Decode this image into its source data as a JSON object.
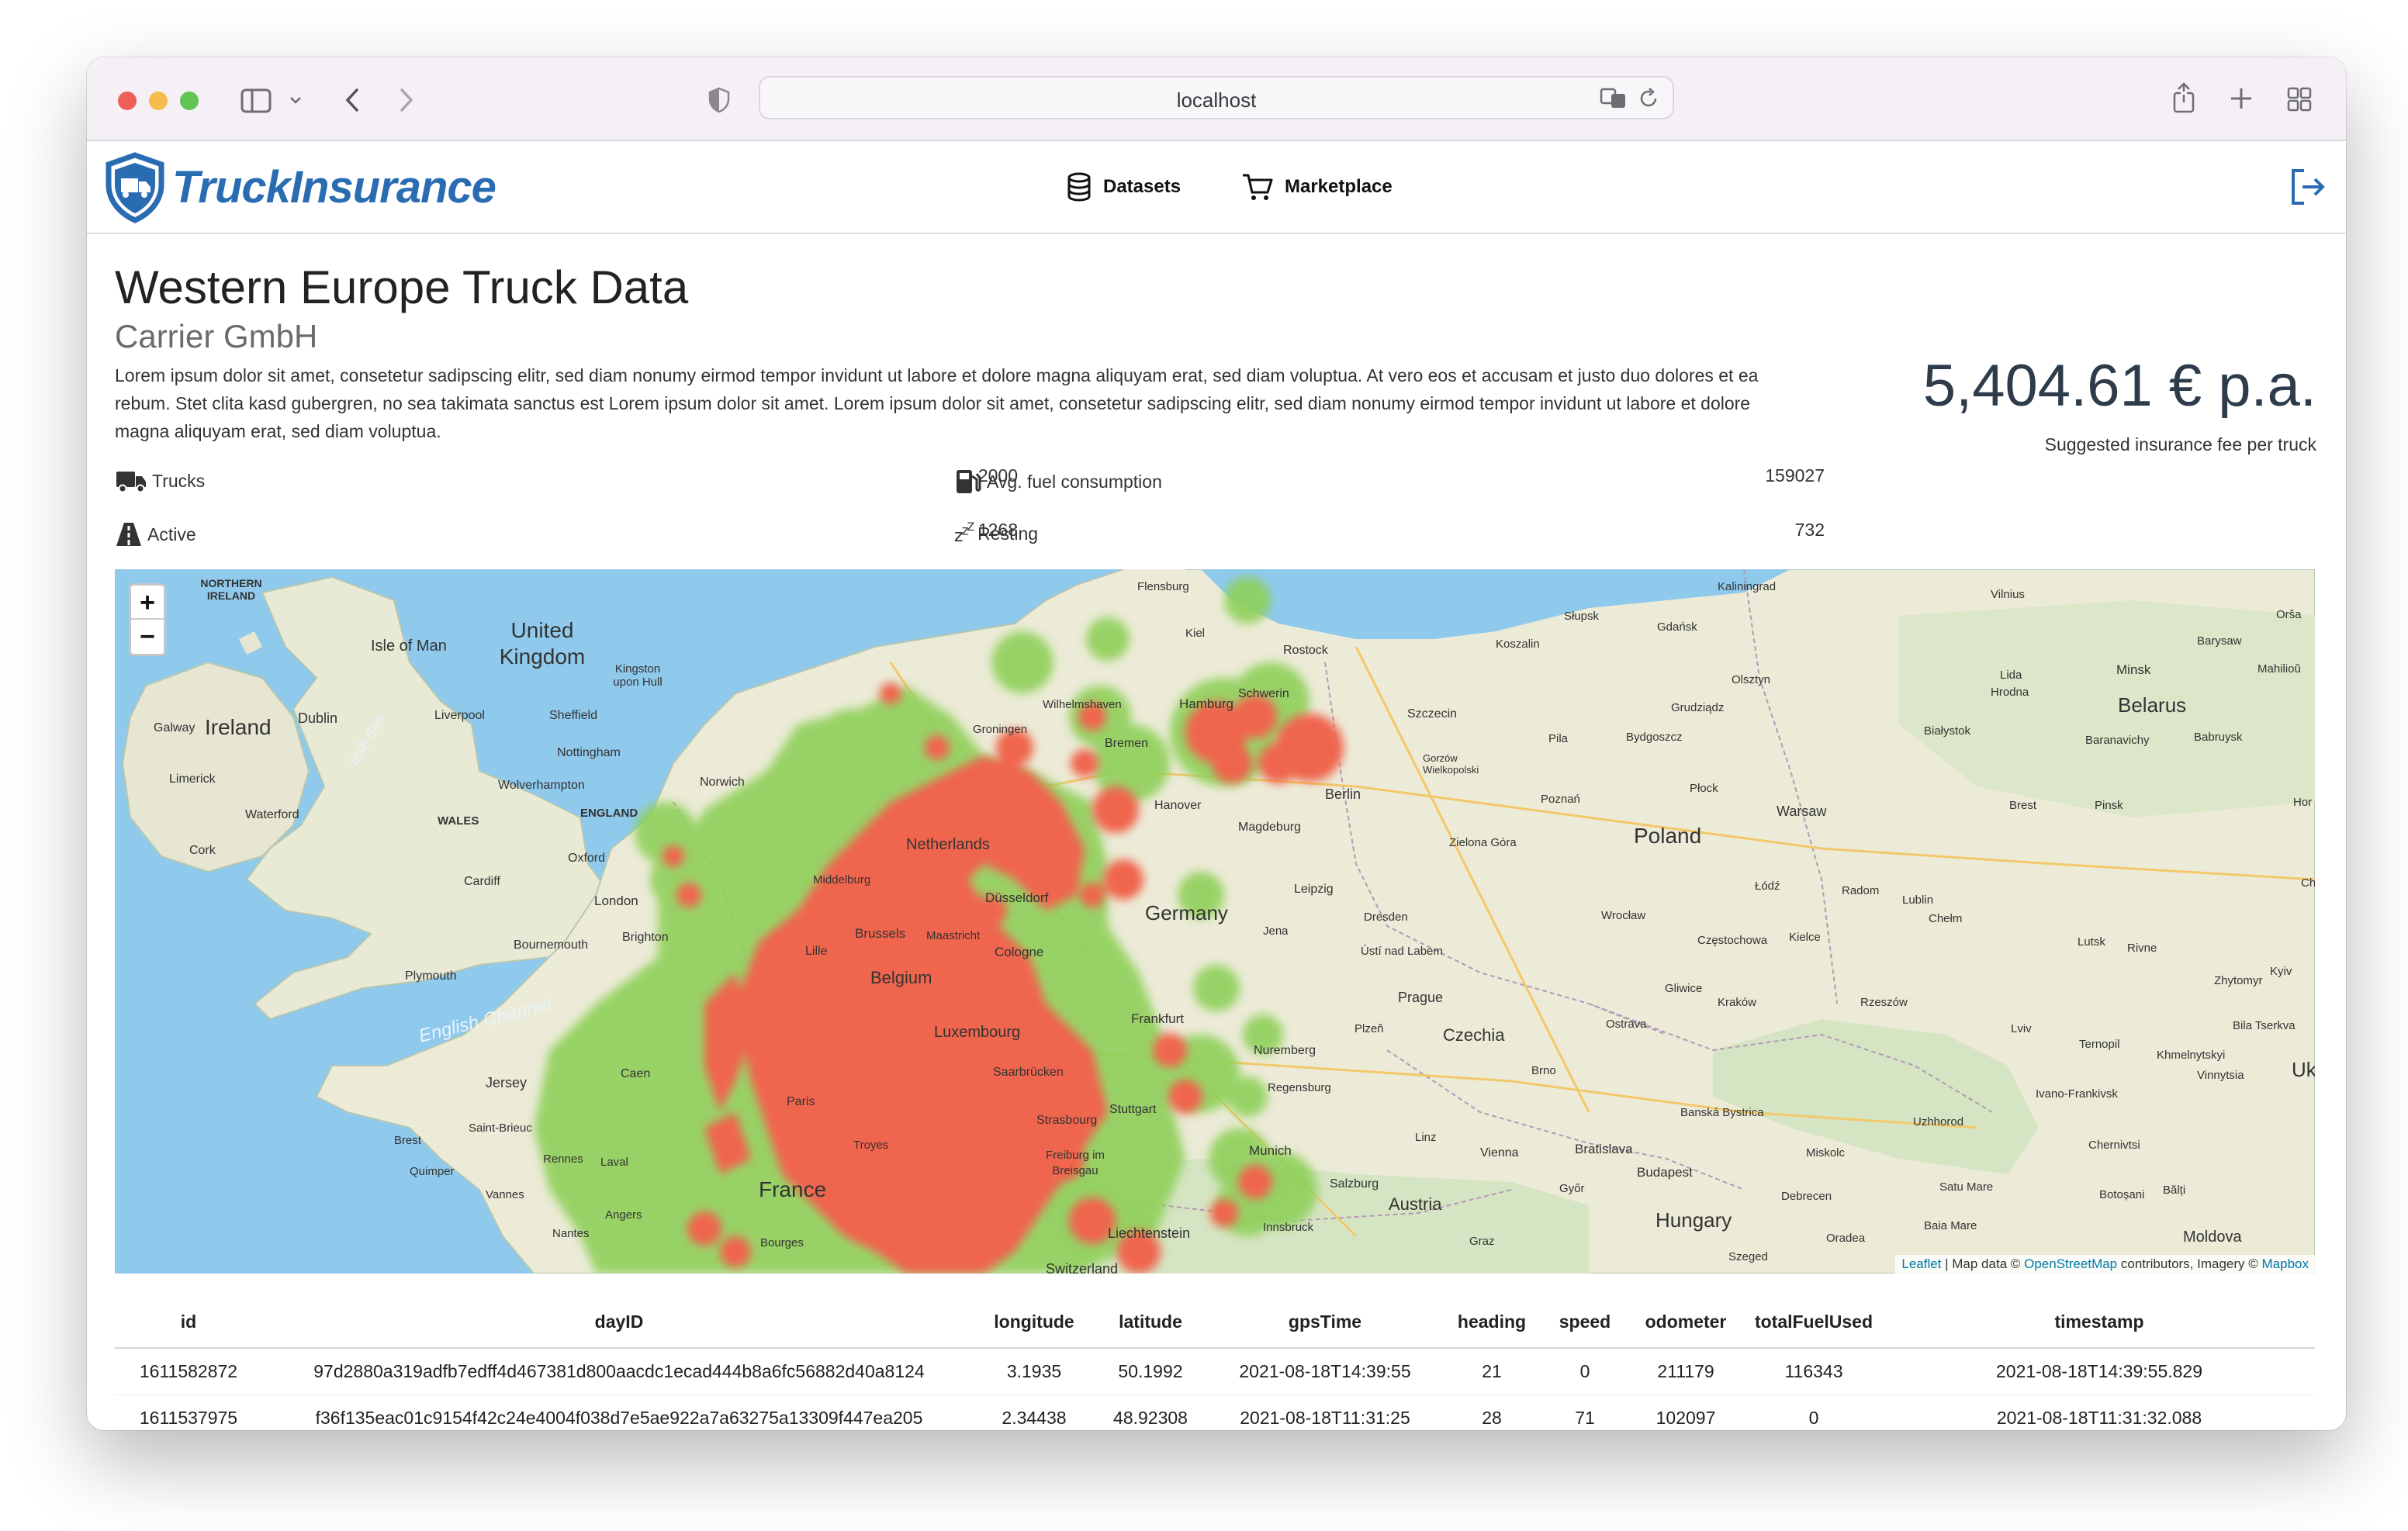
{
  "browser": {
    "address": "localhost"
  },
  "app": {
    "brand": "TruckInsurance",
    "nav": {
      "datasets": "Datasets",
      "marketplace": "Marketplace"
    },
    "colors": {
      "brand": "#2a6cb2",
      "heat_core": "#f0654d",
      "heat_edge": "#8fd05a"
    }
  },
  "dataset": {
    "title": "Western Europe Truck Data",
    "provider": "Carrier GmbH",
    "description": "Lorem ipsum dolor sit amet, consetetur sadipscing elitr, sed diam nonumy eirmod tempor invidunt ut labore et dolore magna aliquyam erat, sed diam voluptua. At vero eos et accusam et justo duo dolores et ea rebum. Stet clita kasd gubergren, no sea takimata sanctus est Lorem ipsum dolor sit amet. Lorem ipsum dolor sit amet, consetetur sadipscing elitr, sed diam nonumy eirmod tempor invidunt ut labore et dolore magna aliquyam erat, sed diam voluptua.",
    "price": "5,404.61 € p.a.",
    "price_label": "Suggested insurance fee per truck",
    "stats": {
      "trucks_label": "Trucks",
      "trucks_value": "2000",
      "fuel_label": "Avg. fuel consumption",
      "fuel_value": "159027",
      "active_label": "Active",
      "active_value": "1268",
      "resting_label": "Resting",
      "resting_value": "732"
    }
  },
  "map": {
    "zoom_in": "+",
    "zoom_out": "−",
    "attribution": {
      "leaflet": "Leaflet",
      "sep": " | Map data © ",
      "osm": "OpenStreetMap",
      "mid": " contributors, Imagery © ",
      "mapbox": "Mapbox"
    },
    "labels": [
      "NORTHERN IRELAND",
      "Isle of Man",
      "United Kingdom",
      "Ireland",
      "Dublin",
      "Galway",
      "Limerick",
      "Waterford",
      "Cork",
      "Liverpool",
      "Sheffield",
      "Kingston upon Hull",
      "Nottingham",
      "WALES",
      "ENGLAND",
      "Cardiff",
      "Oxford",
      "London",
      "Wolverhampton",
      "Norwich",
      "Bournemouth",
      "Brighton",
      "Plymouth",
      "English Channel",
      "Irish Sea",
      "Jersey",
      "Caen",
      "Saint-Brieuc",
      "Brest",
      "Quimper",
      "Rennes",
      "Laval",
      "Vannes",
      "Angers",
      "Nantes",
      "France",
      "Paris",
      "Troyes",
      "Bourges",
      "Lille",
      "Brussels",
      "Belgium",
      "Maastricht",
      "Luxembourg",
      "Middelburg",
      "Netherlands",
      "Groningen",
      "Düsseldorf",
      "Cologne",
      "Frankfurt",
      "Saarbrücken",
      "Strasbourg",
      "Stuttgart",
      "Freiburg im Breisgau",
      "Liechtenstein",
      "Switzerland",
      "Flensburg",
      "Kiel",
      "Wilhelmshaven",
      "Hamburg",
      "Bremen",
      "Schwerin",
      "Rostock",
      "Hanover",
      "Magdeburg",
      "Berlin",
      "Germany",
      "Leipzig",
      "Jena",
      "Dresden",
      "Nuremberg",
      "Regensburg",
      "Munich",
      "Innsbruck",
      "Salzburg",
      "Austria",
      "Graz",
      "Vienna",
      "Linz",
      "Czechia",
      "Prague",
      "Plzeň",
      "Brno",
      "Ústí nad Labem",
      "Ostrava",
      "Bratislava",
      "Győr",
      "Budapest",
      "Hungary",
      "Szeged",
      "Debrecen",
      "Oradea",
      "Poland",
      "Warsaw",
      "Szczecin",
      "Gorzów Wielkopolski",
      "Zielona Góra",
      "Poznań",
      "Bydgoszcz",
      "Gdańsk",
      "Koszalin",
      "Słupsk",
      "Olsztyn",
      "Grudziądz",
      "Płock",
      "Łódź",
      "Radom",
      "Wrocław",
      "Częstochowa",
      "Kielce",
      "Lublin",
      "Chełm",
      "Kraków",
      "Rzeszów",
      "Gliwice",
      "Białystok",
      "Hrodna",
      "Brest",
      "Pinsk",
      "Lutsk",
      "Rivne",
      "Lviv",
      "Ternopil",
      "Ivano-Frankivsk",
      "Chernivtsi",
      "Uzhhorod",
      "Banská Bystrica",
      "Miskolc",
      "Satu Mare",
      "Baia Mare",
      "Botoșani",
      "Bălți",
      "Moldova",
      "Khmelnytskyi",
      "Vinnytsia",
      "Bila Tserkva",
      "Zhytomyr",
      "Kyiv",
      "Uk",
      "Kaliningrad",
      "Vilnius",
      "Lida",
      "Minsk",
      "Belarus",
      "Barysaw",
      "Mahilioŭ",
      "Babruysk",
      "Baranavichy",
      "Orša",
      "Hor",
      "Ch",
      "Pila",
      "Ostrava"
    ]
  },
  "table": {
    "columns": [
      "id",
      "dayID",
      "longitude",
      "latitude",
      "gpsTime",
      "heading",
      "speed",
      "odometer",
      "totalFuelUsed",
      "timestamp"
    ],
    "rows": [
      [
        "1611582872",
        "97d2880a319adfb7edff4d467381d800aacdc1ecad444b8a6fc56882d40a8124",
        "3.1935",
        "50.1992",
        "2021-08-18T14:39:55",
        "21",
        "0",
        "211179",
        "116343",
        "2021-08-18T14:39:55.829"
      ],
      [
        "1611537975",
        "f36f135eac01c9154f42c24e4004f038d7e5ae922a7a63275a13309f447ea205",
        "2.34438",
        "48.92308",
        "2021-08-18T11:31:25",
        "28",
        "71",
        "102097",
        "0",
        "2021-08-18T11:31:32.088"
      ]
    ]
  }
}
